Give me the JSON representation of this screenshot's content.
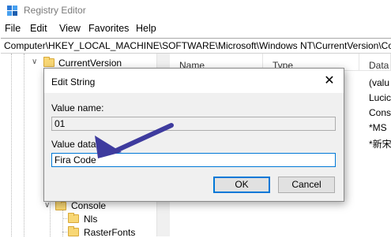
{
  "window": {
    "title": "Registry Editor"
  },
  "menu": [
    "File",
    "Edit",
    "View",
    "Favorites",
    "Help"
  ],
  "address": {
    "path": "Computer\\HKEY_LOCAL_MACHINE\\SOFTWARE\\Microsoft\\Windows NT\\CurrentVersion\\Cor"
  },
  "tree": {
    "items": [
      {
        "label": "CurrentVersion",
        "expanded": true
      },
      {
        "label": "Console",
        "expanded": true
      },
      {
        "label": "Nls",
        "expanded": false
      },
      {
        "label": "RasterFonts",
        "expanded": false
      }
    ]
  },
  "list": {
    "columns": [
      "Name",
      "Type",
      "Data"
    ],
    "data_values": [
      "(valu",
      "Lucic",
      "Cons",
      "*MS",
      "*新宋"
    ]
  },
  "dialog": {
    "title": "Edit String",
    "value_name_label": "Value name:",
    "value_name": "01",
    "value_data_label": "Value data:",
    "value_data": "Fira Code",
    "ok_label": "OK",
    "cancel_label": "Cancel",
    "close_glyph": "✕"
  },
  "colors": {
    "accent": "#0078d7",
    "arrow": "#3e3b9e",
    "folder": "#f8d775"
  },
  "icons": {
    "app": "registry-editor-icon",
    "folder": "folder-icon",
    "expand": "chevron-down-icon",
    "close": "close-icon"
  }
}
